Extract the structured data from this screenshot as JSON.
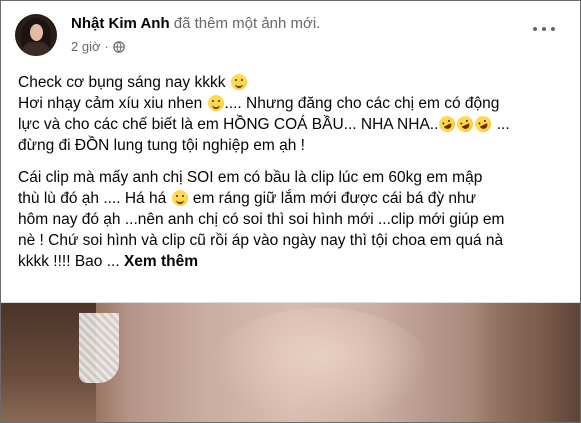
{
  "post": {
    "author": "Nhật Kim Anh",
    "action": "đã thêm một ảnh mới.",
    "time": "2 giờ",
    "separator": "·",
    "privacy_icon": "globe-icon",
    "more_icon": "more-options-icon"
  },
  "text": {
    "p1": {
      "l1": "Check cơ bụng sáng nay kkkk",
      "l2a": "Hơi nhạy cảm xíu xiu nhen",
      "l2b": ".... Nhưng đăng cho các chị em có động",
      "l3a": "lực và cho các chế biết là em HỒNG COÁ BẦU... NHA NHA..",
      "l3b": "...",
      "l4": "đừng đi ĐỒN lung tung tội nghiệp em ạh !"
    },
    "p2": {
      "l1": "Cái clip mà mấy anh chị SOI em có bầu là clip lúc em 60kg em mập",
      "l2": "thù lù đó ạh .... Há há",
      "l2b": "em ráng giữ lắm mới được cái bá đỳ như",
      "l3": "hôm nay đó ạh ...nên anh chị có soi thì soi hình mới ...clip mới giúp em",
      "l4": "nè ! Chứ soi hình và clip cũ rồi áp vào ngày nay thì tội choa em quá nà",
      "l5": "kkkk !!!! Bao ...",
      "see_more": "Xem thêm"
    }
  },
  "emoji": {
    "smile": "smiling-face-icon",
    "wink": "winking-face-tongue-icon",
    "rofl": "rolling-on-floor-laughing-icon",
    "grin": "grinning-face-icon"
  },
  "colors": {
    "text": "#050505",
    "secondary": "#65676b",
    "border": "#6b6b6b"
  }
}
